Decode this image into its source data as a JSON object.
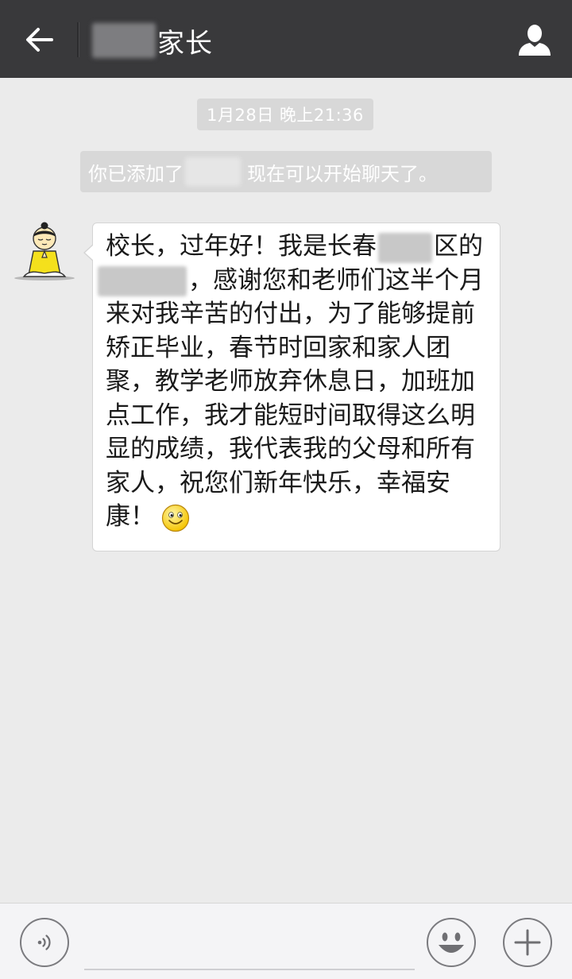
{
  "header": {
    "title_suffix": "家长",
    "back_icon": "arrow-left-icon",
    "profile_icon": "person-icon"
  },
  "chat": {
    "timestamp": "1月28日 晚上21:36",
    "system_message": {
      "before": "你已添加了",
      "after": "现在可以开始聊天了。"
    },
    "message": {
      "line1a": "校长，过年好！我是长春",
      "line1b": "区的",
      "line2": "，感谢您和老师们这半个月",
      "line3": "来对我辛苦的付出，为了能够提前",
      "line4": "矫正毕业，春节时回家和家人团",
      "line5": "聚，教学老师放弃休息日，加班加",
      "line6": "点工作，我才能短时间取得这么明",
      "line7": "显的成绩，我代表我的父母和所有",
      "line8": "家人，祝您们新年快乐，幸福安",
      "line9": "康！",
      "emoji": "smile-emoji-icon"
    }
  },
  "input_bar": {
    "voice_icon": "voice-icon",
    "emoji_icon": "emoji-icon",
    "plus_icon": "plus-icon",
    "input_value": ""
  },
  "colors": {
    "title_bar": "#39393b",
    "background": "#ebebeb",
    "system_bubble": "#d8d8d8",
    "message_bubble": "#ffffff"
  }
}
